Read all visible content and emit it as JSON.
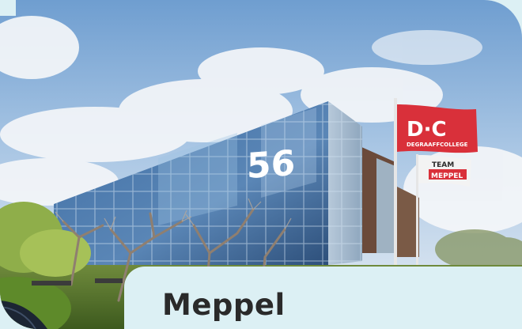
{
  "location": {
    "name": "Meppel"
  },
  "photo": {
    "building_number": "56",
    "flag_logo": "D·C",
    "flag_subtitle": "DEGRAAFFCOLLEGE",
    "banner_text_1": "TEAM",
    "banner_text_2": "MEPPEL"
  },
  "colors": {
    "panel_background": "#dcf0f4",
    "heading_text": "#2a2a2a",
    "flag_red": "#d9303a"
  }
}
